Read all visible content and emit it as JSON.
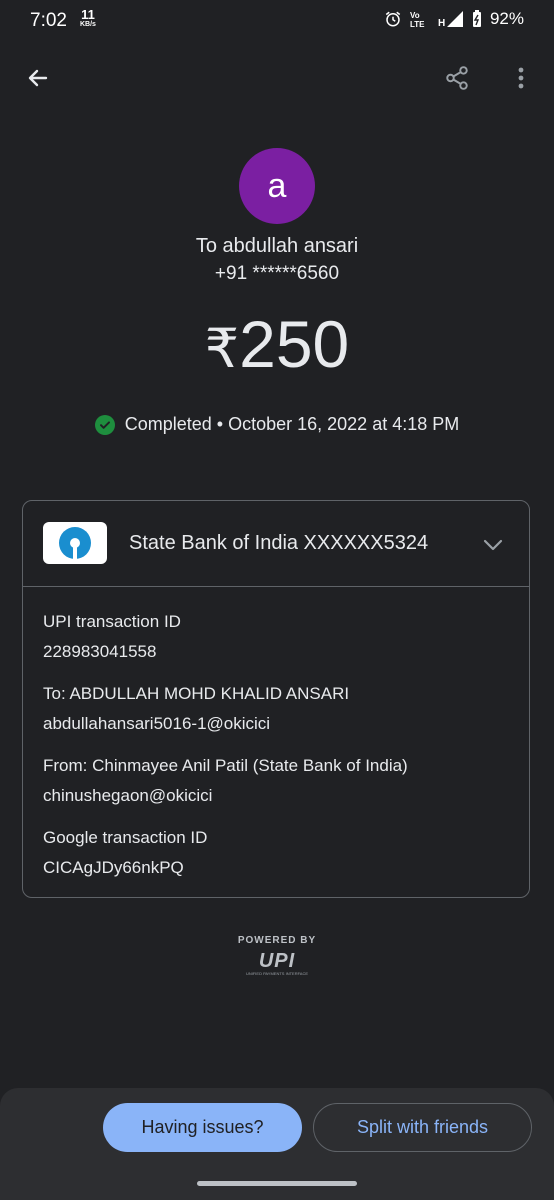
{
  "status_bar": {
    "time": "7:02",
    "net_speed": "11",
    "net_speed_unit": "KB/s",
    "battery": "92%"
  },
  "payee": {
    "avatar_letter": "a",
    "avatar_color": "#7b1fa2",
    "to_line": "To abdullah ansari",
    "phone": "+91 ******6560"
  },
  "amount": {
    "currency": "₹",
    "value": "250"
  },
  "status": {
    "text": "Completed • October 16, 2022 at 4:18 PM",
    "color": "#1e8e3e"
  },
  "account": {
    "bank": "State Bank of India XXXXXX5324"
  },
  "details": [
    {
      "label": "UPI transaction ID",
      "value": "228983041558"
    },
    {
      "label": "To: ABDULLAH MOHD KHALID ANSARI",
      "value": "abdullahansari5016-1@okicici"
    },
    {
      "label": "From: Chinmayee Anil  Patil (State Bank of India)",
      "value": "chinushegaon@okicici"
    },
    {
      "label": "Google transaction ID",
      "value": "CICAgJDy66nkPQ"
    }
  ],
  "footer": {
    "powered_by": "POWERED BY",
    "upi_logo": "UPI",
    "upi_tagline": "UNIFIED PAYMENTS INTERFACE"
  },
  "actions": {
    "issues": "Having issues?",
    "split": "Split with friends"
  },
  "icons": [
    "back-arrow-icon",
    "share-icon",
    "more-vert-icon",
    "check-circle-icon",
    "chevron-down-icon",
    "sbi-logo-icon"
  ]
}
